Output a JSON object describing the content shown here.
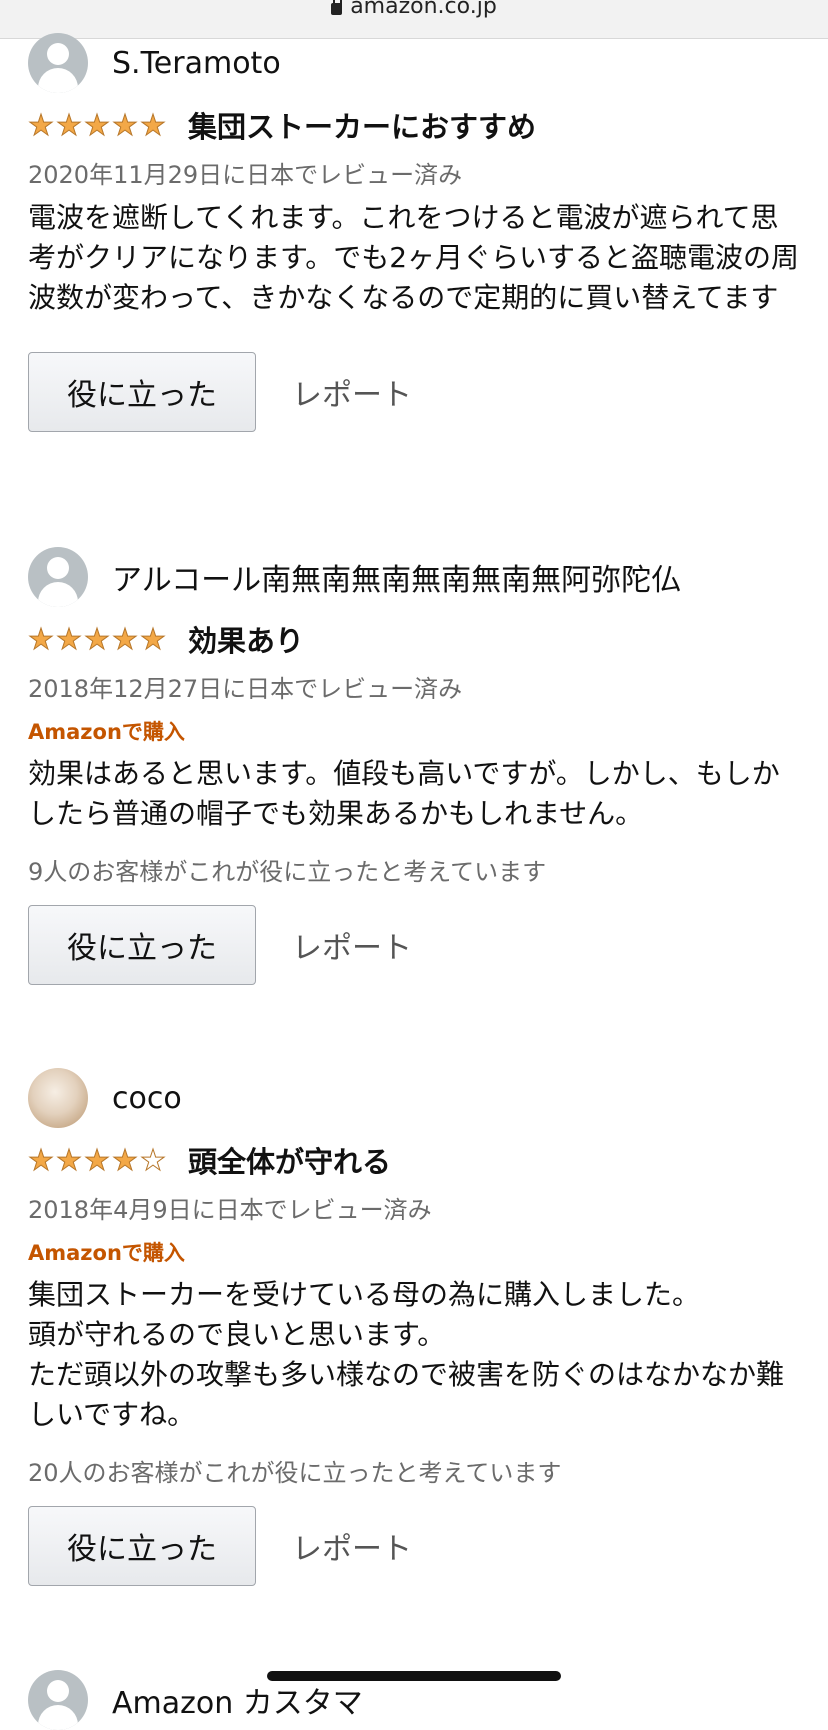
{
  "browser": {
    "url": "amazon.co.jp"
  },
  "reviews": [
    {
      "author": "S.Teramoto",
      "rating": 5,
      "title": "集団ストーカーにおすすめ",
      "date": "2020年11月29日に日本でレビュー済み",
      "verified": "",
      "body": "電波を遮断してくれます。これをつけると電波が遮られて思考がクリアになります。でも2ヶ月ぐらいすると盗聴電波の周波数が変わって、きかなくなるので定期的に買い替えてます",
      "helpful": "",
      "helpful_button": "役に立った",
      "report": "レポート"
    },
    {
      "author": "アルコール南無南無南無南無南無阿弥陀仏",
      "rating": 5,
      "title": "効果あり",
      "date": "2018年12月27日に日本でレビュー済み",
      "verified": "Amazonで購入",
      "body": "効果はあると思います。値段も高いですが。しかし、もしかしたら普通の帽子でも効果あるかもしれません。",
      "helpful": "9人のお客様がこれが役に立ったと考えています",
      "helpful_button": "役に立った",
      "report": "レポート"
    },
    {
      "author": "coco",
      "rating": 4,
      "title": "頭全体が守れる",
      "date": "2018年4月9日に日本でレビュー済み",
      "verified": "Amazonで購入",
      "body": "集団ストーカーを受けている母の為に購入しました。\n頭が守れるので良いと思います。\nただ頭以外の攻撃も多い様なので被害を防ぐのはなかなか難しいですね。",
      "helpful": "20人のお客様がこれが役に立ったと考えています",
      "helpful_button": "役に立った",
      "report": "レポート"
    },
    {
      "author": "Amazon カスタマ"
    }
  ],
  "colors": {
    "star": "#f3a847",
    "verified": "#c45500",
    "muted": "#6b6b6b"
  },
  "icons": {
    "lock": "lock-icon",
    "avatar": "default-avatar-icon",
    "star": "star-icon"
  }
}
